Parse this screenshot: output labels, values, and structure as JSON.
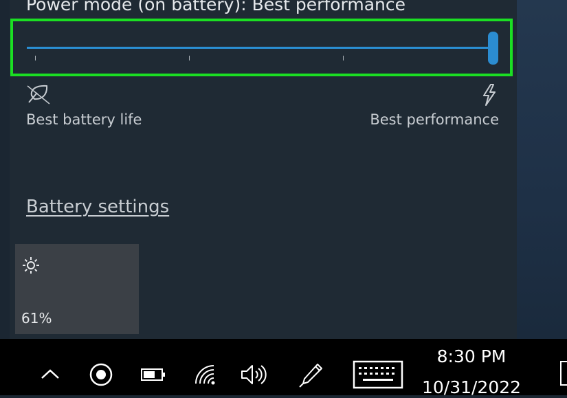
{
  "power_mode": {
    "title": "Power mode (on battery): Best performance",
    "slider_level": 1.0,
    "left_label": "Best battery life",
    "right_label": "Best performance",
    "left_icon": "leaf-icon",
    "right_icon": "lightning-icon",
    "highlight_color": "#1bdf23",
    "accent_color": "#2b8cd0"
  },
  "links": {
    "battery_settings": "Battery settings"
  },
  "brightness": {
    "icon": "sun-icon",
    "value": "61%"
  },
  "taskbar": {
    "icons": [
      "chevron-up-icon",
      "record-icon",
      "battery-icon",
      "wifi-icon",
      "volume-icon",
      "pen-icon",
      "keyboard-icon"
    ],
    "time": "8:30 PM",
    "date": "10/31/2022"
  }
}
